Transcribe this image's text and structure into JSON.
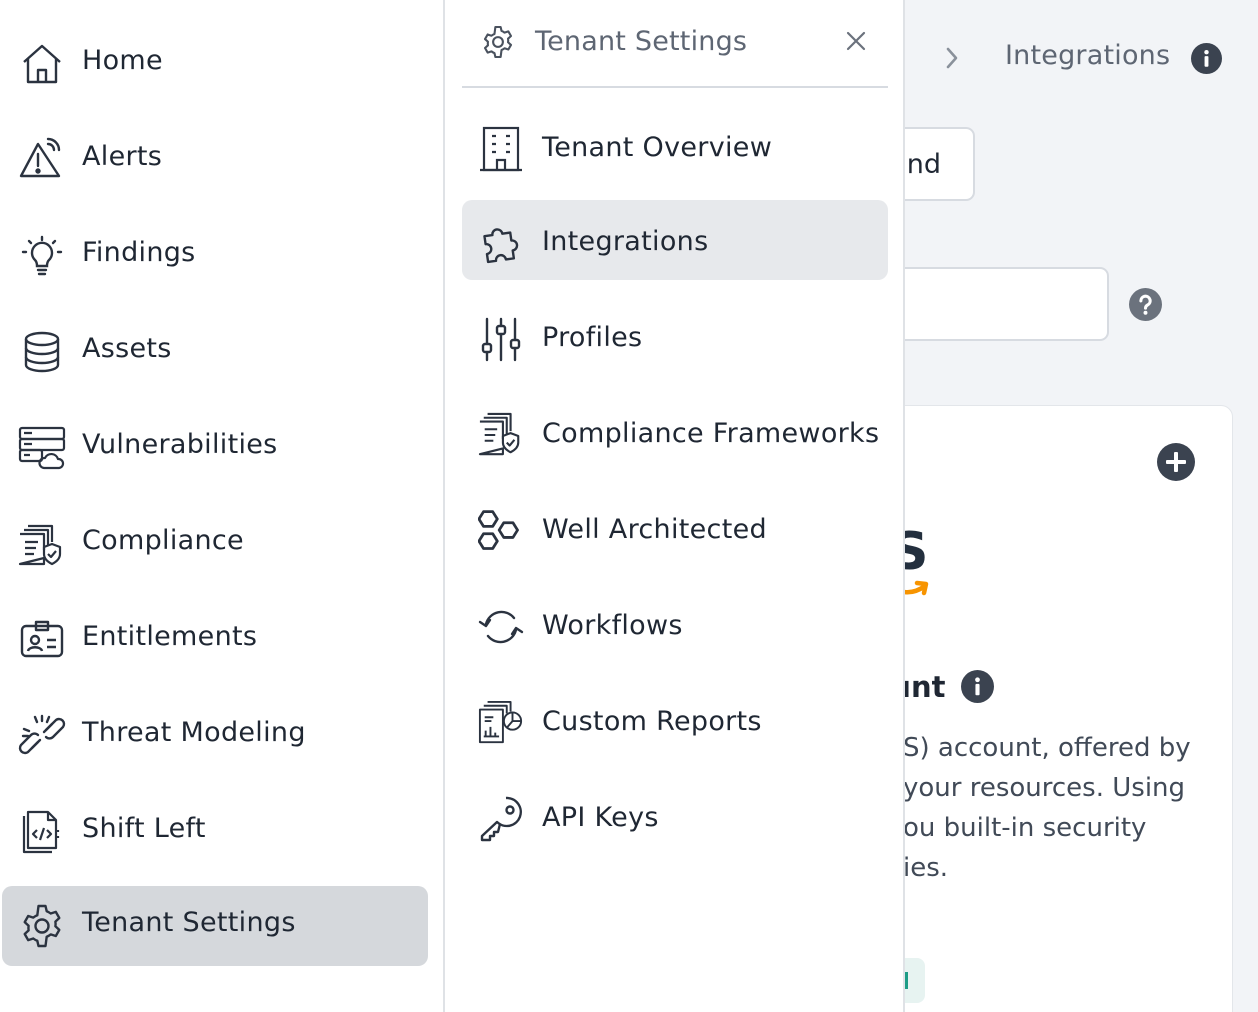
{
  "colors": {
    "background": "#f2f4f7",
    "panel": "#ffffff",
    "active_item": "#d5d8dc",
    "hover_item": "#e7e9ec",
    "text_primary": "#1f2733",
    "text_muted": "#5e6673",
    "aws_orange": "#f79400",
    "aws_navy": "#232f3e"
  },
  "sidebar": {
    "items": [
      {
        "label": "Home",
        "icon": "home-icon"
      },
      {
        "label": "Alerts",
        "icon": "alert-icon"
      },
      {
        "label": "Findings",
        "icon": "lightbulb-icon"
      },
      {
        "label": "Assets",
        "icon": "database-icon"
      },
      {
        "label": "Vulnerabilities",
        "icon": "server-cloud-icon"
      },
      {
        "label": "Compliance",
        "icon": "compliance-doc-icon"
      },
      {
        "label": "Entitlements",
        "icon": "id-card-icon"
      },
      {
        "label": "Threat Modeling",
        "icon": "broken-chain-icon"
      },
      {
        "label": "Shift Left",
        "icon": "code-file-icon"
      },
      {
        "label": "Tenant Settings",
        "icon": "gear-icon",
        "active": true
      }
    ]
  },
  "flyout": {
    "title": "Tenant Settings",
    "title_icon": "gear-icon",
    "close_icon": "close-icon",
    "items": [
      {
        "label": "Tenant Overview",
        "icon": "building-icon"
      },
      {
        "label": "Integrations",
        "icon": "puzzle-icon",
        "active": true
      },
      {
        "label": "Profiles",
        "icon": "sliders-icon"
      },
      {
        "label": "Compliance Frameworks",
        "icon": "compliance-doc-icon"
      },
      {
        "label": "Well Architected",
        "icon": "hexagons-icon"
      },
      {
        "label": "Workflows",
        "icon": "cycle-arrows-icon"
      },
      {
        "label": "Custom Reports",
        "icon": "report-chart-icon"
      },
      {
        "label": "API Keys",
        "icon": "key-icon"
      }
    ]
  },
  "main": {
    "breadcrumb_current": "Integrations",
    "partial_button_text": "ınd",
    "card": {
      "logo_text": "S",
      "title_partial": "ınt",
      "desc_lines": [
        "S) account, offered by",
        "your resources. Using",
        "ou built-in security",
        "ies."
      ]
    }
  }
}
